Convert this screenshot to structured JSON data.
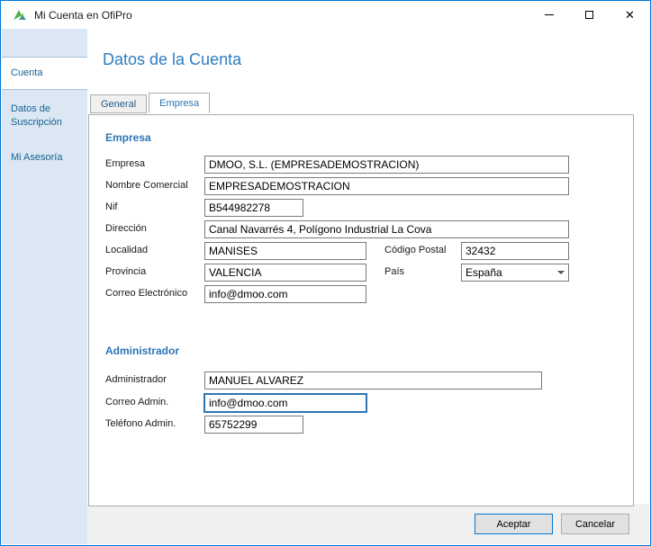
{
  "window": {
    "title": "Mi Cuenta en OfiPro"
  },
  "titlebar": {
    "close_glyph": "✕"
  },
  "sidebar": {
    "items": [
      {
        "label": "Cuenta",
        "selected": true
      },
      {
        "label": "Datos de Suscripción",
        "selected": false
      },
      {
        "label": "Mi Asesoría",
        "selected": false
      }
    ]
  },
  "main": {
    "heading": "Datos de la Cuenta",
    "tabs": [
      {
        "label": "General",
        "selected": false
      },
      {
        "label": "Empresa",
        "selected": true
      }
    ]
  },
  "empresa": {
    "section_title": "Empresa",
    "empresa_label": "Empresa",
    "empresa_value": "DMOO, S.L. (EMPRESADEMOSTRACION)",
    "nombre_comercial_label": "Nombre Comercial",
    "nombre_comercial_value": "EMPRESADEMOSTRACION",
    "nif_label": "Nif",
    "nif_value": "B544982278",
    "direccion_label": "Dirección",
    "direccion_value": "Canal Navarrés 4, Polígono Industrial La Cova",
    "localidad_label": "Localidad",
    "localidad_value": "MANISES",
    "codigo_postal_label": "Código Postal",
    "codigo_postal_value": "32432",
    "provincia_label": "Provincia",
    "provincia_value": "VALENCIA",
    "pais_label": "País",
    "pais_value": "España",
    "correo_label": "Correo Electrónico",
    "correo_value": "info@dmoo.com"
  },
  "administrador": {
    "section_title": "Administrador",
    "admin_label": "Administrador",
    "admin_value": "MANUEL ALVAREZ",
    "correo_admin_label": "Correo Admin.",
    "correo_admin_value": "info@dmoo.com",
    "telefono_admin_label": "Teléfono Admin.",
    "telefono_admin_value": "65752299"
  },
  "footer": {
    "accept": "Aceptar",
    "cancel": "Cancelar"
  }
}
